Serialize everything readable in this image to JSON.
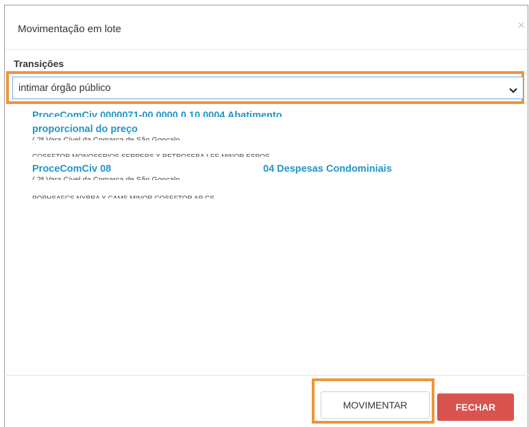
{
  "modal": {
    "title": "Movimentação em lote",
    "close_icon": "close-icon",
    "close_glyph": "×"
  },
  "transitions": {
    "label": "Transições",
    "selected": "intimar órgão público",
    "icon": "chevron-down-icon"
  },
  "processes": [
    {
      "title_line1": "ProceComCiv 0000071-00.0000.0.10.0004 Abatimento",
      "title_line2": "proporcional do preço",
      "court": "( 2ª Vara Cível da Comarca de São Gonçalo",
      "parties": "COSEFTOR MONOSERIOS SERPERS X RETROSEBA.LEE MINOR ESPOS"
    },
    {
      "title_left": "ProceComCiv 08",
      "title_right": "04 Despesas Condominiais",
      "court": "( 2ª Vara Cível da Comarca de São Gonçalo",
      "parties": "POPHSAFCS NYBRA X CAMS MINOR COSEFTOR AP CS"
    }
  ],
  "footer": {
    "move_label": "MOVIMENTAR",
    "close_label": "FECHAR"
  },
  "colors": {
    "highlight": "#f0943a",
    "link": "#2196c9",
    "danger": "#d9534f"
  }
}
